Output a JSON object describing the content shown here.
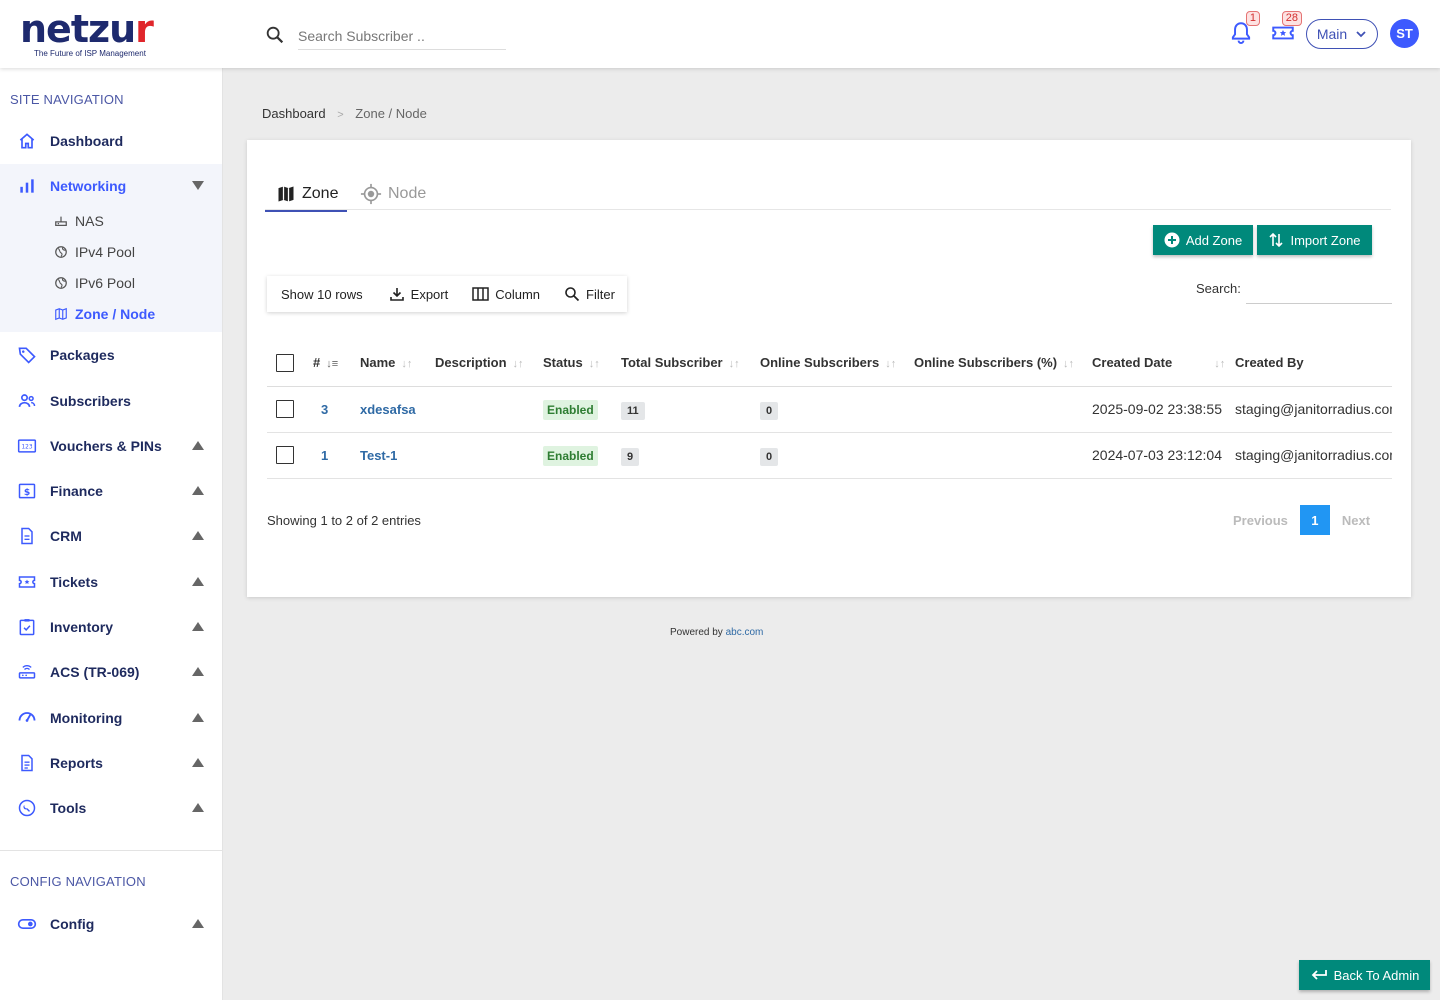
{
  "brand": {
    "name_main": "netzu",
    "name_accent": "r",
    "tagline": "The Future of ISP Management"
  },
  "header": {
    "search_placeholder": "Search Subscriber ..",
    "notifications_count": "1",
    "tickets_count": "28",
    "workspace_select": "Main",
    "avatar_initials": "ST"
  },
  "sidebar": {
    "site_nav_title": "SITE NAVIGATION",
    "items": [
      {
        "label": "Dashboard"
      },
      {
        "label": "Networking"
      },
      {
        "label": "Packages"
      },
      {
        "label": "Subscribers"
      },
      {
        "label": "Vouchers & PINs"
      },
      {
        "label": "Finance"
      },
      {
        "label": "CRM"
      },
      {
        "label": "Tickets"
      },
      {
        "label": "Inventory"
      },
      {
        "label": "ACS (TR-069)"
      },
      {
        "label": "Monitoring"
      },
      {
        "label": "Reports"
      },
      {
        "label": "Tools"
      }
    ],
    "networking_sub": [
      {
        "label": "NAS"
      },
      {
        "label": "IPv4 Pool"
      },
      {
        "label": "IPv6 Pool"
      },
      {
        "label": "Zone / Node"
      }
    ],
    "config_nav_title": "CONFIG NAVIGATION",
    "config_item": "Config"
  },
  "breadcrumb": {
    "root": "Dashboard",
    "separator": ">",
    "current": "Zone / Node"
  },
  "tabs": {
    "zone": "Zone",
    "node": "Node"
  },
  "actions": {
    "add": "Add Zone",
    "import": "Import Zone"
  },
  "toolbar": {
    "rows": "Show 10 rows",
    "export": "Export",
    "column": "Column",
    "filter": "Filter"
  },
  "search": {
    "label": "Search:"
  },
  "table": {
    "headers": [
      "#",
      "Name",
      "Description",
      "Status",
      "Total Subscriber",
      "Online Subscribers",
      "Online Subscribers (%)",
      "Created Date",
      "Created By"
    ],
    "rows": [
      {
        "id": "3",
        "name": "xdesafsa",
        "description": "",
        "status": "Enabled",
        "total": "11",
        "online": "0",
        "online_pct": "",
        "created": "2025-09-02 23:38:55",
        "by": "staging@janitorradius.com"
      },
      {
        "id": "1",
        "name": "Test-1",
        "description": "",
        "status": "Enabled",
        "total": "9",
        "online": "0",
        "online_pct": "",
        "created": "2024-07-03 23:12:04",
        "by": "staging@janitorradius.com"
      }
    ]
  },
  "pagination": {
    "summary": "Showing 1 to 2 of 2 entries",
    "previous": "Previous",
    "page": "1",
    "next": "Next"
  },
  "footer": {
    "text": "Powered by",
    "link": "abc.com"
  },
  "back_button": "Back To Admin",
  "colors": {
    "primary": "#3d5afe",
    "teal": "#00897b",
    "navy": "#1e2a5e",
    "link": "#2f6aa5"
  }
}
